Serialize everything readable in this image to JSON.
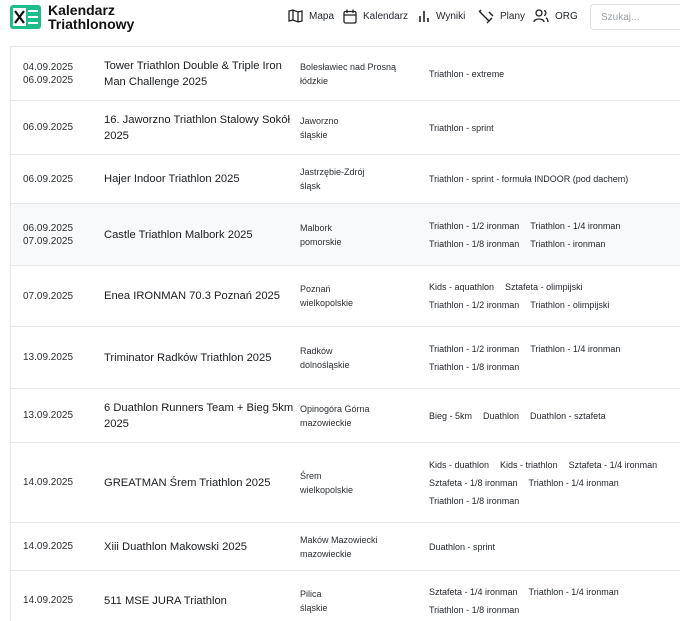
{
  "header": {
    "brand_line1": "Kalendarz",
    "brand_line2": "Triathlonowy",
    "nav": [
      {
        "label": "Mapa",
        "icon": "map-icon"
      },
      {
        "label": "Kalendarz",
        "icon": "calendar-icon"
      },
      {
        "label": "Wyniki",
        "icon": "bar-chart-icon"
      },
      {
        "label": "Plany",
        "icon": "plan-icon"
      },
      {
        "label": "ORG",
        "icon": "users-icon"
      }
    ],
    "search_placeholder": "Szukaj...",
    "accent": "#1dbe8c"
  },
  "events": [
    {
      "dates": [
        "04.09.2025",
        "06.09.2025"
      ],
      "name": "Tower Triathlon Double & Triple Iron Man Challenge 2025",
      "place": "Bolesławiec nad Prosną",
      "region": "łódzkie",
      "tags": [
        [
          "Triathlon - extreme"
        ]
      ]
    },
    {
      "dates": [
        "06.09.2025"
      ],
      "name": "16. Jaworzno Triathlon Stalowy Sokół 2025",
      "place": "Jaworzno",
      "region": "śląskie",
      "tags": [
        [
          "Triathlon - sprint"
        ]
      ]
    },
    {
      "dates": [
        "06.09.2025"
      ],
      "name": "Hajer Indoor Triathlon 2025",
      "place": "Jastrzębie-Zdrój",
      "region": "śląsk",
      "tags": [
        [
          "Triathlon - sprint - formuła INDOOR (pod dachem)"
        ]
      ]
    },
    {
      "dates": [
        "06.09.2025",
        "07.09.2025"
      ],
      "name": "Castle Triathlon Malbork 2025",
      "place": "Malbork",
      "region": "pomorskie",
      "tags": [
        [
          "Triathlon - 1/2 ironman",
          "Triathlon - 1/4 ironman"
        ],
        [
          "Triathlon - 1/8 ironman",
          "Triathlon - ironman"
        ]
      ]
    },
    {
      "dates": [
        "07.09.2025"
      ],
      "name": "Enea IRONMAN 70.3 Poznań 2025",
      "place": "Poznań",
      "region": "wielkopolskie",
      "tags": [
        [
          "Kids - aquathlon",
          "Sztafeta - olimpijski"
        ],
        [
          "Triathlon - 1/2 ironman",
          "Triathlon - olimpijski"
        ]
      ]
    },
    {
      "dates": [
        "13.09.2025"
      ],
      "name": "Triminator Radków Triathlon 2025",
      "place": "Radków",
      "region": "dolnośląskie",
      "tags": [
        [
          "Triathlon - 1/2 ironman",
          "Triathlon - 1/4 ironman"
        ],
        [
          "Triathlon - 1/8 ironman"
        ]
      ]
    },
    {
      "dates": [
        "13.09.2025"
      ],
      "name": "6 Duathlon Runners Team + Bieg 5km 2025",
      "place": "Opinogóra Górna",
      "region": "mazowieckie",
      "tags": [
        [
          "Bieg - 5km",
          "Duathlon",
          "Duathlon - sztafeta"
        ]
      ]
    },
    {
      "dates": [
        "14.09.2025"
      ],
      "name": "GREATMAN Śrem Triathlon 2025",
      "place": "Śrem",
      "region": "wielkopolskie",
      "tags": [
        [
          "Kids - duathlon",
          "Kids - triathlon",
          "Sztafeta - 1/4 ironman"
        ],
        [
          "Sztafeta - 1/8 ironman",
          "Triathlon - 1/4 ironman"
        ],
        [
          "Triathlon - 1/8 ironman"
        ]
      ]
    },
    {
      "dates": [
        "14.09.2025"
      ],
      "name": "Xiii Duathlon Makowski 2025",
      "place": "Maków Mazowiecki",
      "region": "mazowieckie",
      "tags": [
        [
          "Duathlon - sprint"
        ]
      ]
    },
    {
      "dates": [
        "14.09.2025"
      ],
      "name": "511 MSE JURA Triathlon",
      "place": "Pilica",
      "region": "śląskie",
      "tags": [
        [
          "Sztafeta - 1/4 ironman",
          "Triathlon - 1/4 ironman"
        ],
        [
          "Triathlon - 1/8 ironman"
        ]
      ]
    }
  ]
}
